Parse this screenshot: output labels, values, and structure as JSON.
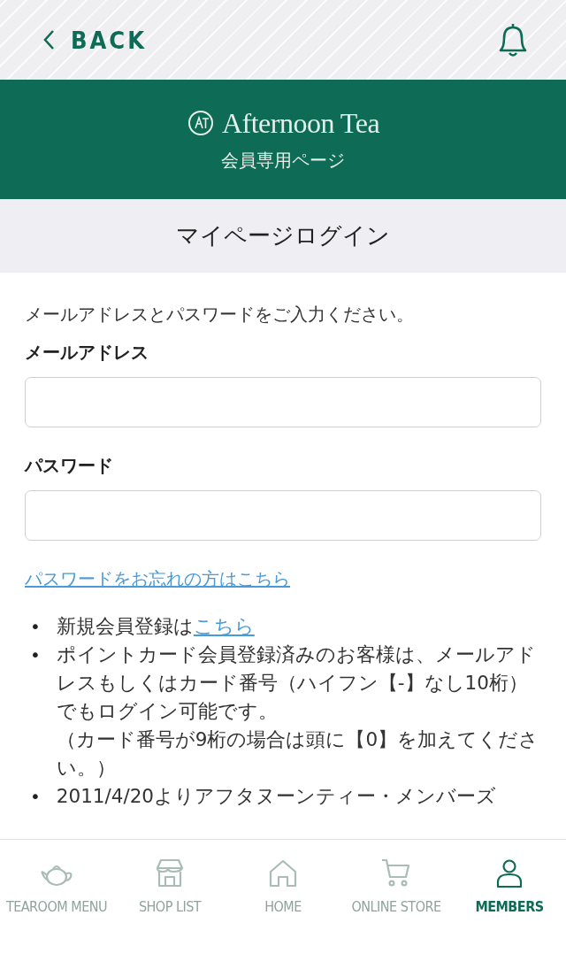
{
  "top_bar": {
    "back": "BACK"
  },
  "brand": {
    "logo": "Afternoon Tea",
    "subtitle": "会員専用ページ"
  },
  "page_title": "マイページログイン",
  "form": {
    "intro": "メールアドレスとパスワードをご入力ください。",
    "fields": [
      {
        "label": "メールアドレス"
      },
      {
        "label": "パスワード"
      }
    ],
    "forgot_link": "パスワードをお忘れの方はこちら"
  },
  "notes": [
    {
      "marker": "•",
      "text": "新規会員登録は",
      "link": "こちら"
    },
    {
      "marker": "•",
      "text": "ポイントカード会員登録済みのお客様は、メールアドレスもしくはカード番号（ハイフン【-】なし10桁）でもログイン可能です。",
      "note": "（カード番号が9桁の場合は頭に【0】を加えてください。）"
    },
    {
      "marker": "•",
      "text": "2011/4/20よりアフタヌーンティー・メンバーズ"
    }
  ],
  "tab_bar": [
    {
      "kind": "teapot",
      "label": "TEAROOM MENU",
      "selected": false
    },
    {
      "kind": "shop",
      "label": "SHOP LIST",
      "selected": false
    },
    {
      "kind": "home",
      "label": "HOME",
      "selected": false
    },
    {
      "kind": "cart",
      "label": "ONLINE STORE",
      "selected": false
    },
    {
      "kind": "person",
      "label": "MEMBERS",
      "selected": true
    }
  ]
}
